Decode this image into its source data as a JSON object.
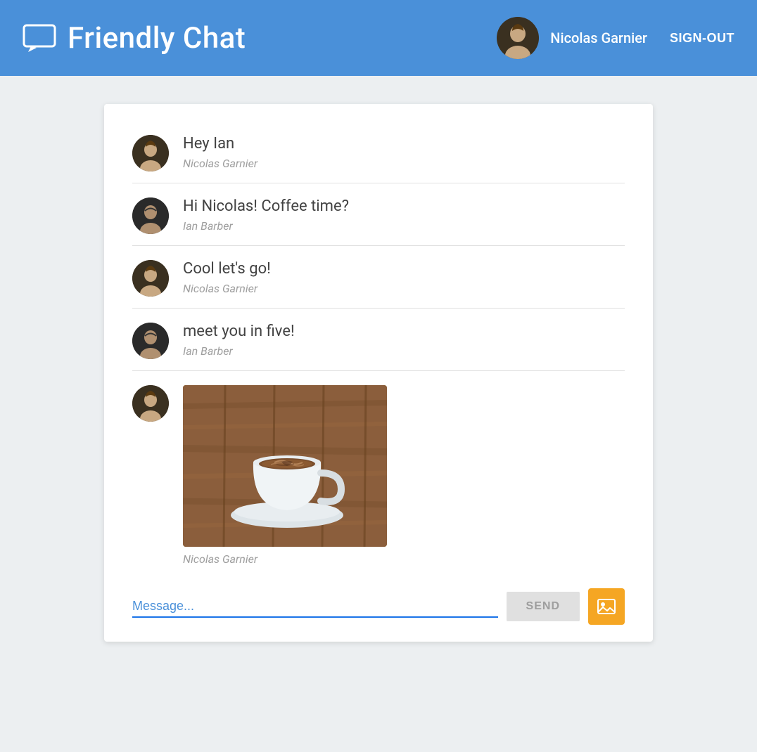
{
  "header": {
    "title": "Friendly Chat",
    "user": {
      "name": "Nicolas Garnier",
      "sign_out": "SIGN-OUT"
    }
  },
  "chat": {
    "messages": [
      {
        "id": 1,
        "text": "Hey Ian",
        "author": "Nicolas Garnier",
        "avatar_type": "nicolas",
        "image": null
      },
      {
        "id": 2,
        "text": "Hi Nicolas! Coffee time?",
        "author": "Ian Barber",
        "avatar_type": "ian",
        "image": null
      },
      {
        "id": 3,
        "text": "Cool let's go!",
        "author": "Nicolas Garnier",
        "avatar_type": "nicolas",
        "image": null
      },
      {
        "id": 4,
        "text": "meet you in five!",
        "author": "Ian Barber",
        "avatar_type": "ian",
        "image": null
      },
      {
        "id": 5,
        "text": null,
        "author": "Nicolas Garnier",
        "avatar_type": "nicolas",
        "image": "coffee"
      }
    ],
    "input_placeholder": "Message...",
    "send_button": "SEND"
  }
}
